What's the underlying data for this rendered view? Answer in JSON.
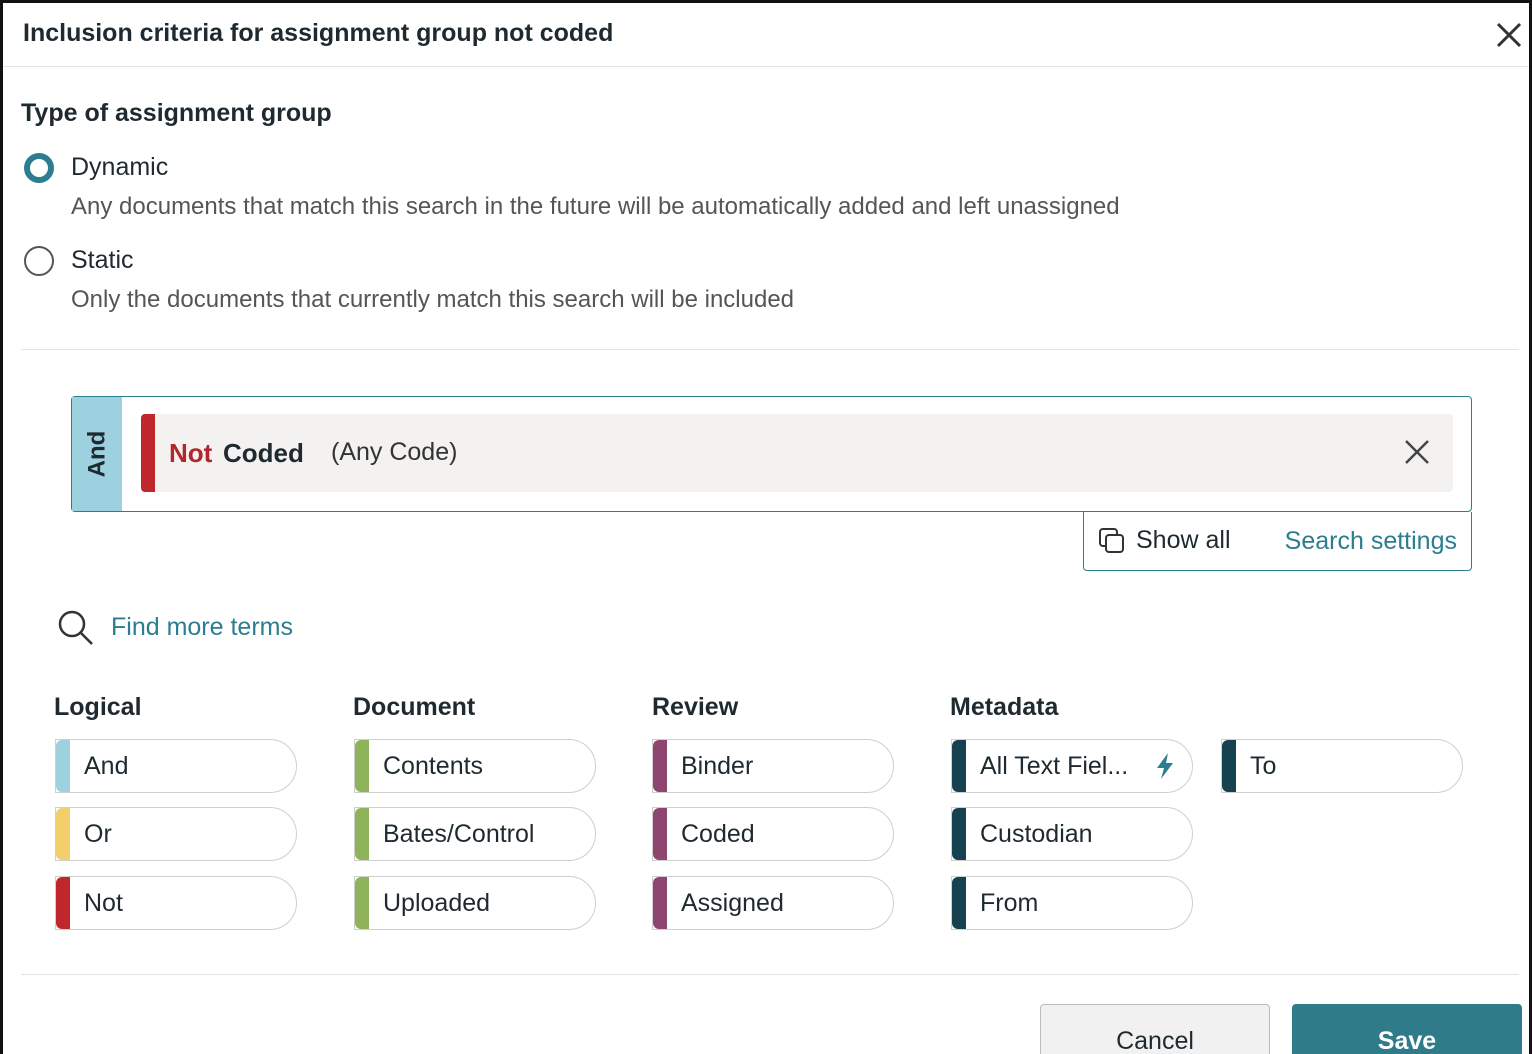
{
  "dialog": {
    "title": "Inclusion criteria for assignment group not coded"
  },
  "assignment_type": {
    "heading": "Type of assignment group",
    "options": [
      {
        "label": "Dynamic",
        "description": "Any documents that match this search in the future will be automatically added and left unassigned",
        "selected": true
      },
      {
        "label": "Static",
        "description": "Only the documents that currently match this search will be included",
        "selected": false
      }
    ]
  },
  "query": {
    "operator": "And",
    "term": {
      "negation": "Not",
      "field": "Coded",
      "value": "(Any Code)"
    },
    "show_all_label": "Show all",
    "search_settings_label": "Search settings"
  },
  "find_more": {
    "label": "Find more terms"
  },
  "categories": [
    {
      "heading": "Logical",
      "items": [
        {
          "label": "And",
          "color": "#9dd1df"
        },
        {
          "label": "Or",
          "color": "#f2cf6a"
        },
        {
          "label": "Not",
          "color": "#c0272d"
        }
      ]
    },
    {
      "heading": "Document",
      "items": [
        {
          "label": "Contents",
          "color": "#8fb35a"
        },
        {
          "label": "Bates/Control",
          "color": "#8fb35a"
        },
        {
          "label": "Uploaded",
          "color": "#8fb35a"
        }
      ]
    },
    {
      "heading": "Review",
      "items": [
        {
          "label": "Binder",
          "color": "#8e4670"
        },
        {
          "label": "Coded",
          "color": "#8e4670"
        },
        {
          "label": "Assigned",
          "color": "#8e4670"
        }
      ]
    },
    {
      "heading": "Metadata",
      "items": [
        {
          "label": "All Text Fiel...",
          "color": "#16414f",
          "icon": "lightning-icon"
        },
        {
          "label": "Custodian",
          "color": "#16414f"
        },
        {
          "label": "From",
          "color": "#16414f"
        },
        {
          "label": "To",
          "color": "#16414f"
        }
      ]
    }
  ],
  "footer": {
    "cancel_label": "Cancel",
    "save_label": "Save"
  },
  "colors": {
    "accent": "#2c7d8f",
    "save_button": "#2f7b8a",
    "not_red": "#b3262c"
  }
}
